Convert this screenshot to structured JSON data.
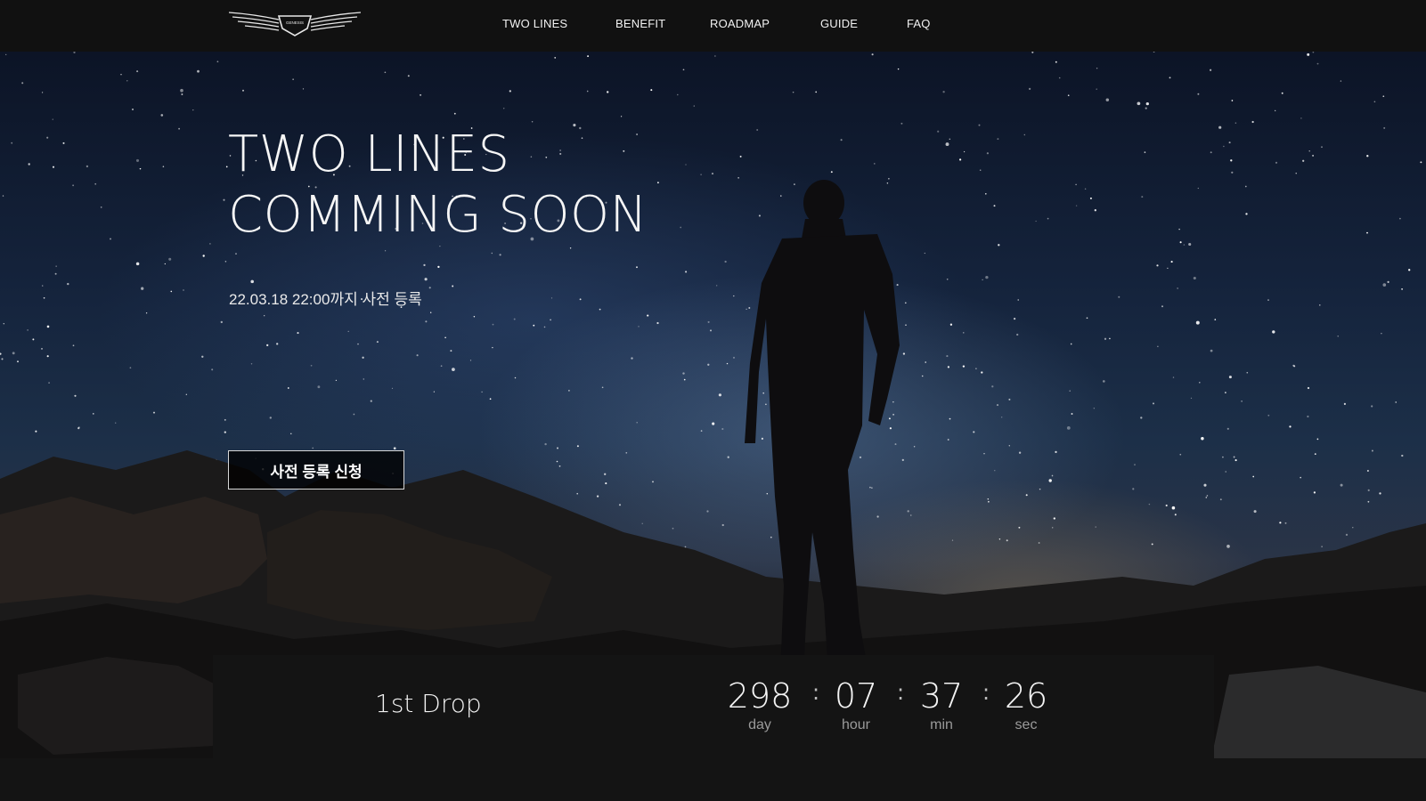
{
  "nav": {
    "logo_text": "GENESIS",
    "items": [
      {
        "label": "TWO LINES"
      },
      {
        "label": "BENEFIT"
      },
      {
        "label": "ROADMAP"
      },
      {
        "label": "GUIDE"
      },
      {
        "label": "FAQ"
      }
    ]
  },
  "hero": {
    "title_line1": "TWO LINES",
    "title_line2": "COMMING SOON",
    "subtitle": "22.03.18 22:00까지 사전 등록",
    "cta_label": "사전 등록 신청"
  },
  "countdown": {
    "drop_label": "1st Drop",
    "days": "298",
    "days_label": "day",
    "hours": "07",
    "hours_label": "hour",
    "minutes": "37",
    "minutes_label": "min",
    "seconds": "26",
    "seconds_label": "sec",
    "separator": ":"
  },
  "colors": {
    "header_bg": "#111111",
    "panel_bg": "#141414",
    "text": "#ffffff",
    "muted": "#9a9a9a"
  }
}
